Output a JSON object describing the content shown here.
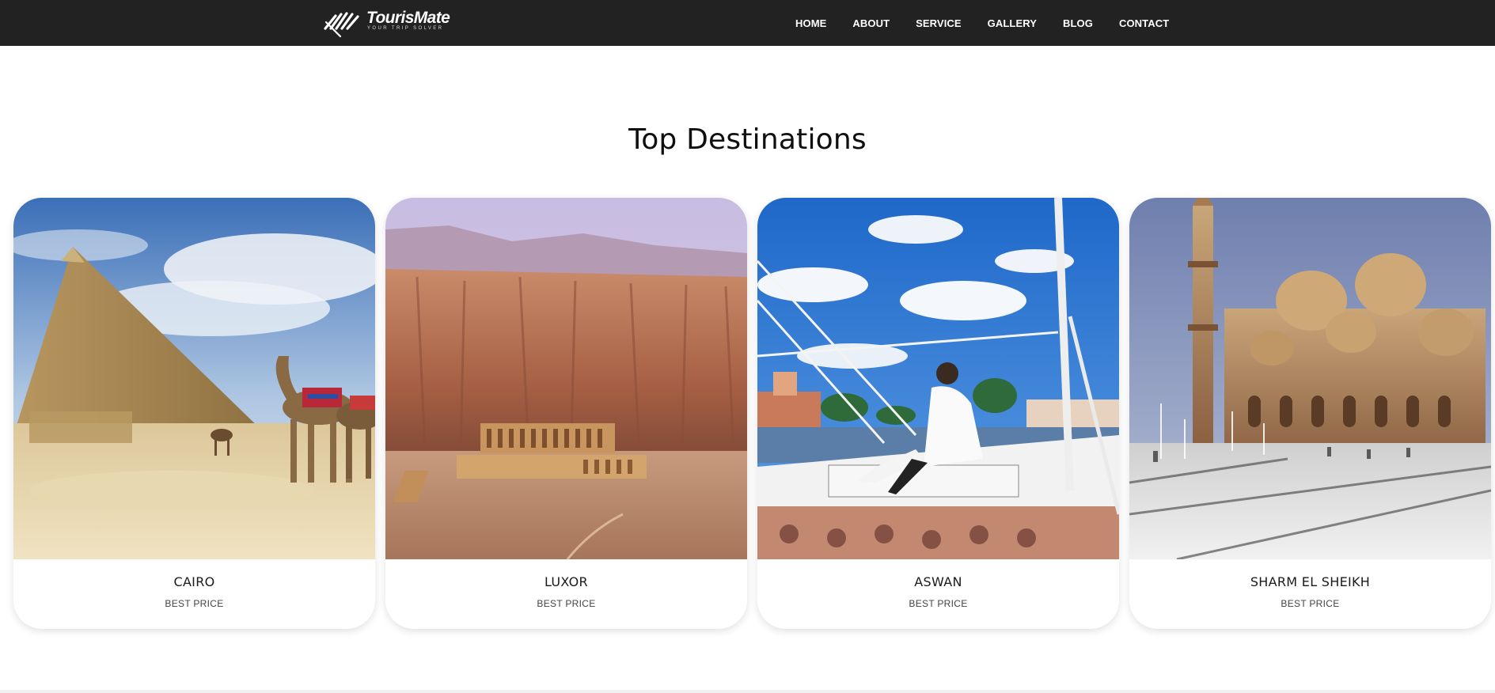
{
  "brand": {
    "name": "TourisMate",
    "tagline": "YOUR TRIP SOLVER"
  },
  "nav": {
    "items": [
      {
        "label": "HOME"
      },
      {
        "label": "ABOUT"
      },
      {
        "label": "SERVICE"
      },
      {
        "label": "GALLERY"
      },
      {
        "label": "BLOG"
      },
      {
        "label": "CONTACT"
      }
    ]
  },
  "section": {
    "title": "Top Destinations"
  },
  "destinations": [
    {
      "name": "CAIRO",
      "price_label": "BEST PRICE",
      "image": "pyramids-camels-photo"
    },
    {
      "name": "LUXOR",
      "price_label": "BEST PRICE",
      "image": "hatshepsut-temple-cliffs-photo"
    },
    {
      "name": "ASWAN",
      "price_label": "BEST PRICE",
      "image": "felucca-sailboat-nile-photo"
    },
    {
      "name": "SHARM EL SHEIKH",
      "price_label": "BEST PRICE",
      "image": "mosque-fountains-photo"
    }
  ],
  "colors": {
    "navbar_bg": "#222222",
    "nav_text": "#ffffff",
    "page_bg": "#ffffff"
  }
}
